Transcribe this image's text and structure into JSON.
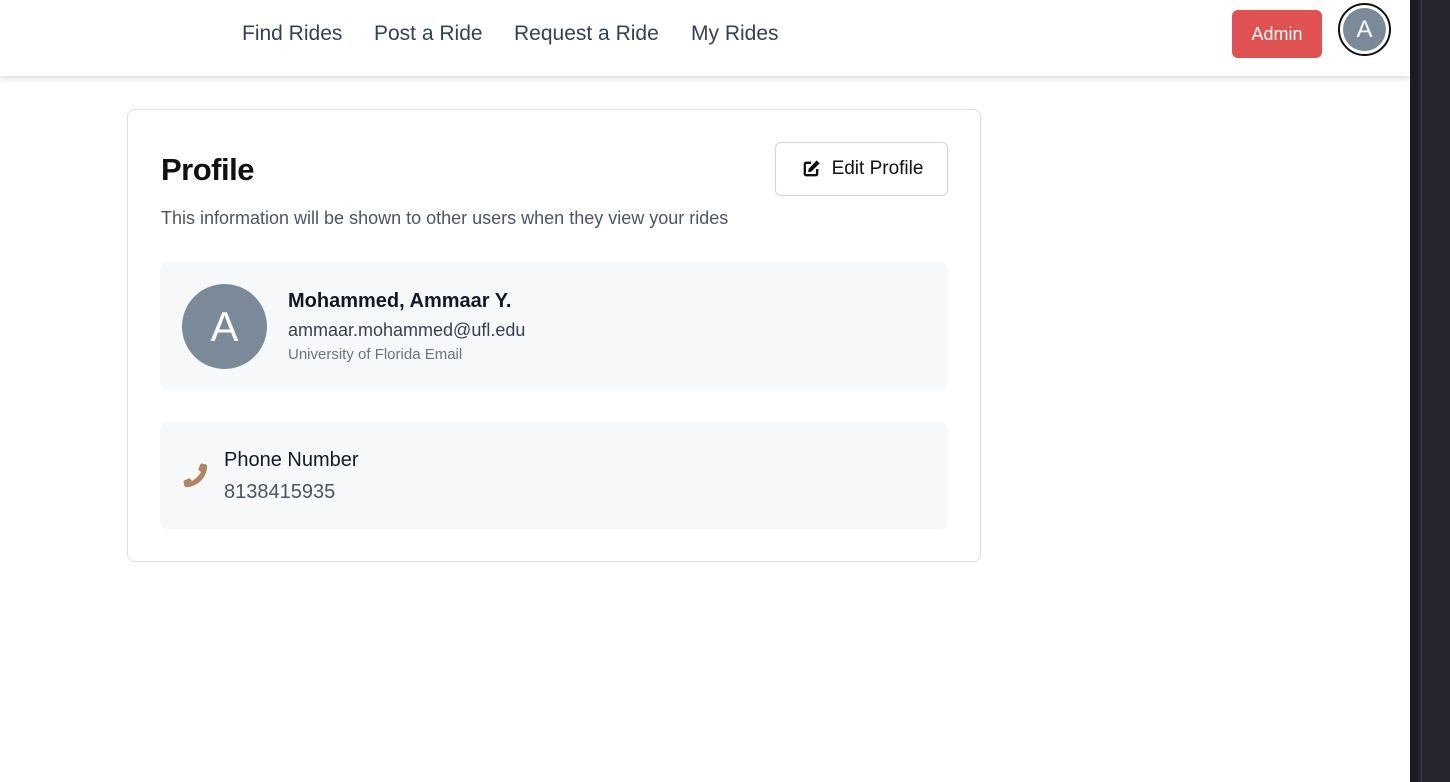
{
  "nav": {
    "links": [
      "Find Rides",
      "Post a Ride",
      "Request a Ride",
      "My Rides"
    ],
    "admin_label": "Admin",
    "avatar_initial": "A"
  },
  "profile": {
    "title": "Profile",
    "edit_label": "Edit Profile",
    "subtitle": "This information will be shown to other users when they view your rides",
    "avatar_initial": "A",
    "name": "Mohammed, Ammaar Y.",
    "email": "ammaar.mohammed@ufl.edu",
    "email_caption": "University of Florida Email",
    "phone_label": "Phone Number",
    "phone_value": "8138415935"
  },
  "colors": {
    "admin_red": "#e05252",
    "avatar_gray": "#7a8a99",
    "phone_icon_tan": "#b08660"
  },
  "icons": {
    "edit": "pen-square-icon",
    "phone": "phone-icon"
  }
}
